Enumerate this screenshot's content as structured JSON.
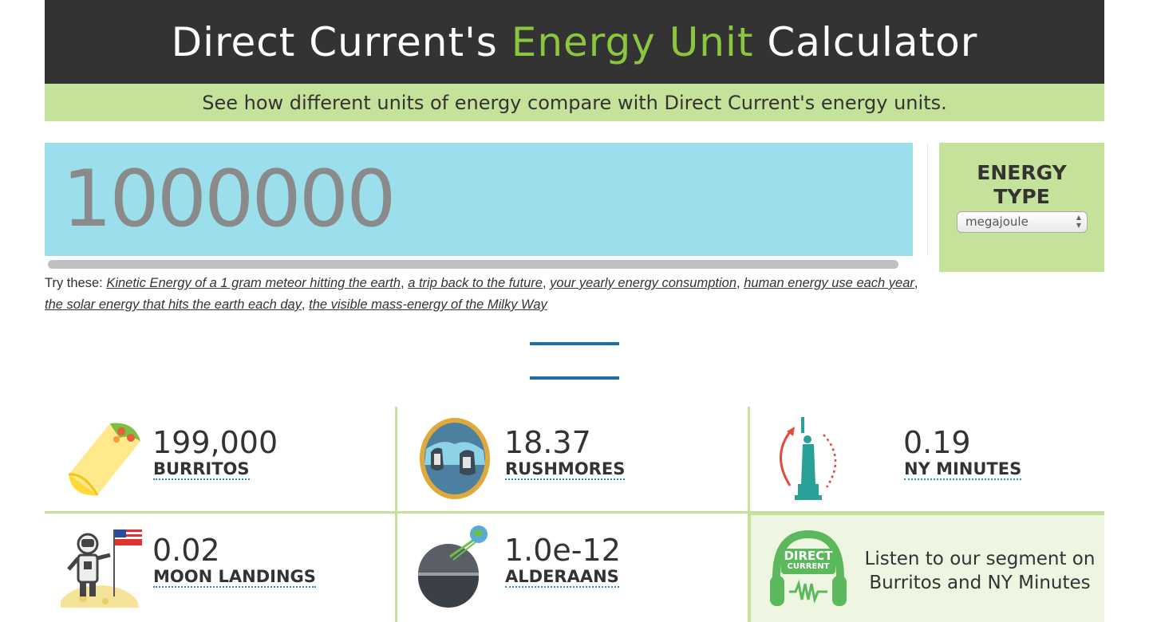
{
  "header": {
    "title_prefix": "Direct Current's ",
    "title_accent": "Energy Unit",
    "title_suffix": " Calculator",
    "subtitle": "See how different units of energy compare with Direct Current's energy units.",
    "accent_color": "#8cc63f",
    "bar_color": "#333333",
    "subtitle_bg": "#c5e29a"
  },
  "calculator": {
    "input_value": "1000000",
    "input_bg": "#9bdfed",
    "energy_type_label_line1": "ENERGY",
    "energy_type_label_line2": "TYPE",
    "energy_type_selected": "megajoule"
  },
  "suggestions": {
    "prefix": "Try these: ",
    "links": [
      "Kinetic Energy of a 1 gram meteor hitting the earth",
      "a trip back to the future",
      "your yearly energy consumption",
      "human energy use each year",
      "the solar energy that hits the earth each day",
      "the visible mass-energy of the Milky Way"
    ]
  },
  "results": [
    {
      "value": "199,000",
      "unit": "BURRITOS",
      "icon": "burrito-icon"
    },
    {
      "value": "18.37",
      "unit": "RUSHMORES",
      "icon": "mount-rushmore-icon"
    },
    {
      "value": "0.19",
      "unit": "NY MINUTES",
      "icon": "statue-of-liberty-icon"
    },
    {
      "value": "0.02",
      "unit": "MOON LANDINGS",
      "icon": "astronaut-icon"
    },
    {
      "value": "1.0e-12",
      "unit": "ALDERAANS",
      "icon": "death-star-icon"
    }
  ],
  "listen": {
    "logo_line1": "DIRECT",
    "logo_line2": "CURRENT",
    "text": "Listen to our segment on Burritos and NY Minutes",
    "icon": "headphones-icon"
  }
}
